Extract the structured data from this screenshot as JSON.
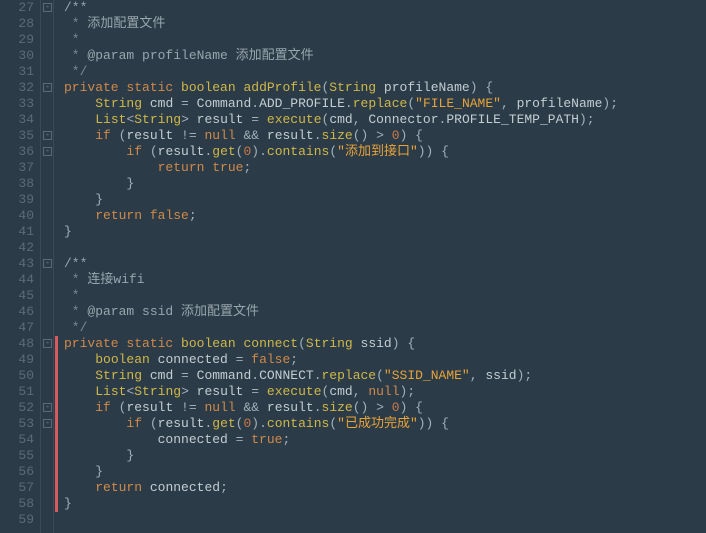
{
  "lines": [
    {
      "n": 27,
      "fold": "minus",
      "tokens": [
        [
          "c-comment",
          "/**"
        ]
      ]
    },
    {
      "n": 28,
      "tokens": [
        [
          "c-star",
          " * "
        ],
        [
          "c-comment",
          "添加配置文件"
        ]
      ]
    },
    {
      "n": 29,
      "tokens": [
        [
          "c-star",
          " *"
        ]
      ]
    },
    {
      "n": 30,
      "tokens": [
        [
          "c-star",
          " * "
        ],
        [
          "c-doctag",
          "@param"
        ],
        [
          "c-comment",
          " profileName 添加配置文件"
        ]
      ]
    },
    {
      "n": 31,
      "tokens": [
        [
          "c-star",
          " */"
        ]
      ]
    },
    {
      "n": 32,
      "fold": "minus",
      "tokens": [
        [
          "c-kw",
          "private"
        ],
        [
          "c-punc",
          " "
        ],
        [
          "c-kw",
          "static"
        ],
        [
          "c-punc",
          " "
        ],
        [
          "c-type",
          "boolean"
        ],
        [
          "c-punc",
          " "
        ],
        [
          "c-func",
          "addProfile"
        ],
        [
          "c-punc",
          "("
        ],
        [
          "c-type",
          "String"
        ],
        [
          "c-punc",
          " "
        ],
        [
          "c-ident",
          "profileName"
        ],
        [
          "c-punc",
          ") {"
        ]
      ]
    },
    {
      "n": 33,
      "tokens": [
        [
          "c-punc",
          "    "
        ],
        [
          "c-type",
          "String"
        ],
        [
          "c-punc",
          " "
        ],
        [
          "c-ident",
          "cmd"
        ],
        [
          "c-punc",
          " = "
        ],
        [
          "c-ident",
          "Command"
        ],
        [
          "c-punc",
          "."
        ],
        [
          "c-ident",
          "ADD_PROFILE"
        ],
        [
          "c-punc",
          "."
        ],
        [
          "c-func",
          "replace"
        ],
        [
          "c-punc",
          "("
        ],
        [
          "c-str-hl",
          "\"FILE_NAME\""
        ],
        [
          "c-punc",
          ", "
        ],
        [
          "c-ident",
          "profileName"
        ],
        [
          "c-punc",
          ");"
        ]
      ]
    },
    {
      "n": 34,
      "tokens": [
        [
          "c-punc",
          "    "
        ],
        [
          "c-type",
          "List"
        ],
        [
          "c-punc",
          "<"
        ],
        [
          "c-type",
          "String"
        ],
        [
          "c-punc",
          "> "
        ],
        [
          "c-ident",
          "result"
        ],
        [
          "c-punc",
          " = "
        ],
        [
          "c-func",
          "execute"
        ],
        [
          "c-punc",
          "("
        ],
        [
          "c-ident",
          "cmd"
        ],
        [
          "c-punc",
          ", "
        ],
        [
          "c-ident",
          "Connector"
        ],
        [
          "c-punc",
          "."
        ],
        [
          "c-ident",
          "PROFILE_TEMP_PATH"
        ],
        [
          "c-punc",
          ");"
        ]
      ]
    },
    {
      "n": 35,
      "fold": "minus",
      "tokens": [
        [
          "c-punc",
          "    "
        ],
        [
          "c-kw",
          "if"
        ],
        [
          "c-punc",
          " ("
        ],
        [
          "c-ident",
          "result"
        ],
        [
          "c-punc",
          " != "
        ],
        [
          "c-bool",
          "null"
        ],
        [
          "c-punc",
          " && "
        ],
        [
          "c-ident",
          "result"
        ],
        [
          "c-punc",
          "."
        ],
        [
          "c-func",
          "size"
        ],
        [
          "c-punc",
          "() > "
        ],
        [
          "c-num",
          "0"
        ],
        [
          "c-punc",
          ") {"
        ]
      ]
    },
    {
      "n": 36,
      "fold": "minus",
      "tokens": [
        [
          "c-punc",
          "        "
        ],
        [
          "c-kw",
          "if"
        ],
        [
          "c-punc",
          " ("
        ],
        [
          "c-ident",
          "result"
        ],
        [
          "c-punc",
          "."
        ],
        [
          "c-func",
          "get"
        ],
        [
          "c-punc",
          "("
        ],
        [
          "c-num",
          "0"
        ],
        [
          "c-punc",
          ")."
        ],
        [
          "c-func",
          "contains"
        ],
        [
          "c-punc",
          "("
        ],
        [
          "c-str-hl",
          "\"添加到接口\""
        ],
        [
          "c-punc",
          ")) {"
        ]
      ]
    },
    {
      "n": 37,
      "tokens": [
        [
          "c-punc",
          "            "
        ],
        [
          "c-kw",
          "return"
        ],
        [
          "c-punc",
          " "
        ],
        [
          "c-bool",
          "true"
        ],
        [
          "c-punc",
          ";"
        ]
      ]
    },
    {
      "n": 38,
      "tokens": [
        [
          "c-punc",
          "        }"
        ]
      ]
    },
    {
      "n": 39,
      "tokens": [
        [
          "c-punc",
          "    }"
        ]
      ]
    },
    {
      "n": 40,
      "tokens": [
        [
          "c-punc",
          "    "
        ],
        [
          "c-kw",
          "return"
        ],
        [
          "c-punc",
          " "
        ],
        [
          "c-bool",
          "false"
        ],
        [
          "c-punc",
          ";"
        ]
      ]
    },
    {
      "n": 41,
      "tokens": [
        [
          "c-punc",
          "}"
        ]
      ]
    },
    {
      "n": 42,
      "tokens": [
        [
          "c-punc",
          ""
        ]
      ]
    },
    {
      "n": 43,
      "fold": "minus",
      "tokens": [
        [
          "c-comment",
          "/**"
        ]
      ]
    },
    {
      "n": 44,
      "tokens": [
        [
          "c-star",
          " * "
        ],
        [
          "c-comment",
          "连接wifi"
        ]
      ]
    },
    {
      "n": 45,
      "tokens": [
        [
          "c-star",
          " *"
        ]
      ]
    },
    {
      "n": 46,
      "tokens": [
        [
          "c-star",
          " * "
        ],
        [
          "c-doctag",
          "@param"
        ],
        [
          "c-comment",
          " ssid 添加配置文件"
        ]
      ]
    },
    {
      "n": 47,
      "tokens": [
        [
          "c-star",
          " */"
        ]
      ]
    },
    {
      "n": 48,
      "fold": "minus",
      "changed": true,
      "tokens": [
        [
          "c-kw",
          "private"
        ],
        [
          "c-punc",
          " "
        ],
        [
          "c-kw",
          "static"
        ],
        [
          "c-punc",
          " "
        ],
        [
          "c-type",
          "boolean"
        ],
        [
          "c-punc",
          " "
        ],
        [
          "c-func",
          "connect"
        ],
        [
          "c-punc",
          "("
        ],
        [
          "c-type",
          "String"
        ],
        [
          "c-punc",
          " "
        ],
        [
          "c-ident",
          "ssid"
        ],
        [
          "c-punc",
          ") {"
        ]
      ]
    },
    {
      "n": 49,
      "changed": true,
      "tokens": [
        [
          "c-punc",
          "    "
        ],
        [
          "c-type",
          "boolean"
        ],
        [
          "c-punc",
          " "
        ],
        [
          "c-ident",
          "connected"
        ],
        [
          "c-punc",
          " = "
        ],
        [
          "c-bool",
          "false"
        ],
        [
          "c-punc",
          ";"
        ]
      ]
    },
    {
      "n": 50,
      "changed": true,
      "tokens": [
        [
          "c-punc",
          "    "
        ],
        [
          "c-type",
          "String"
        ],
        [
          "c-punc",
          " "
        ],
        [
          "c-ident",
          "cmd"
        ],
        [
          "c-punc",
          " = "
        ],
        [
          "c-ident",
          "Command"
        ],
        [
          "c-punc",
          "."
        ],
        [
          "c-ident",
          "CONNECT"
        ],
        [
          "c-punc",
          "."
        ],
        [
          "c-func",
          "replace"
        ],
        [
          "c-punc",
          "("
        ],
        [
          "c-str-hl",
          "\"SSID_NAME\""
        ],
        [
          "c-punc",
          ", "
        ],
        [
          "c-ident",
          "ssid"
        ],
        [
          "c-punc",
          ");"
        ]
      ]
    },
    {
      "n": 51,
      "changed": true,
      "tokens": [
        [
          "c-punc",
          "    "
        ],
        [
          "c-type",
          "List"
        ],
        [
          "c-punc",
          "<"
        ],
        [
          "c-type",
          "String"
        ],
        [
          "c-punc",
          "> "
        ],
        [
          "c-ident",
          "result"
        ],
        [
          "c-punc",
          " = "
        ],
        [
          "c-func",
          "execute"
        ],
        [
          "c-punc",
          "("
        ],
        [
          "c-ident",
          "cmd"
        ],
        [
          "c-punc",
          ", "
        ],
        [
          "c-bool",
          "null"
        ],
        [
          "c-punc",
          ");"
        ]
      ]
    },
    {
      "n": 52,
      "fold": "minus",
      "changed": true,
      "tokens": [
        [
          "c-punc",
          "    "
        ],
        [
          "c-kw",
          "if"
        ],
        [
          "c-punc",
          " ("
        ],
        [
          "c-ident",
          "result"
        ],
        [
          "c-punc",
          " != "
        ],
        [
          "c-bool",
          "null"
        ],
        [
          "c-punc",
          " && "
        ],
        [
          "c-ident",
          "result"
        ],
        [
          "c-punc",
          "."
        ],
        [
          "c-func",
          "size"
        ],
        [
          "c-punc",
          "() > "
        ],
        [
          "c-num",
          "0"
        ],
        [
          "c-punc",
          ") {"
        ]
      ]
    },
    {
      "n": 53,
      "fold": "minus",
      "changed": true,
      "tokens": [
        [
          "c-punc",
          "        "
        ],
        [
          "c-kw",
          "if"
        ],
        [
          "c-punc",
          " ("
        ],
        [
          "c-ident",
          "result"
        ],
        [
          "c-punc",
          "."
        ],
        [
          "c-func",
          "get"
        ],
        [
          "c-punc",
          "("
        ],
        [
          "c-num",
          "0"
        ],
        [
          "c-punc",
          ")."
        ],
        [
          "c-func",
          "contains"
        ],
        [
          "c-punc",
          "("
        ],
        [
          "c-str-hl",
          "\"已成功完成\""
        ],
        [
          "c-punc",
          ")) {"
        ]
      ]
    },
    {
      "n": 54,
      "changed": true,
      "tokens": [
        [
          "c-punc",
          "            "
        ],
        [
          "c-ident",
          "connected"
        ],
        [
          "c-punc",
          " = "
        ],
        [
          "c-bool",
          "true"
        ],
        [
          "c-punc",
          ";"
        ]
      ]
    },
    {
      "n": 55,
      "changed": true,
      "tokens": [
        [
          "c-punc",
          "        }"
        ]
      ]
    },
    {
      "n": 56,
      "changed": true,
      "tokens": [
        [
          "c-punc",
          "    }"
        ]
      ]
    },
    {
      "n": 57,
      "changed": true,
      "tokens": [
        [
          "c-punc",
          "    "
        ],
        [
          "c-kw",
          "return"
        ],
        [
          "c-punc",
          " "
        ],
        [
          "c-ident",
          "connected"
        ],
        [
          "c-punc",
          ";"
        ]
      ]
    },
    {
      "n": 58,
      "changed": true,
      "tokens": [
        [
          "c-punc",
          "}"
        ]
      ]
    },
    {
      "n": 59,
      "tokens": [
        [
          "c-punc",
          ""
        ]
      ]
    }
  ]
}
